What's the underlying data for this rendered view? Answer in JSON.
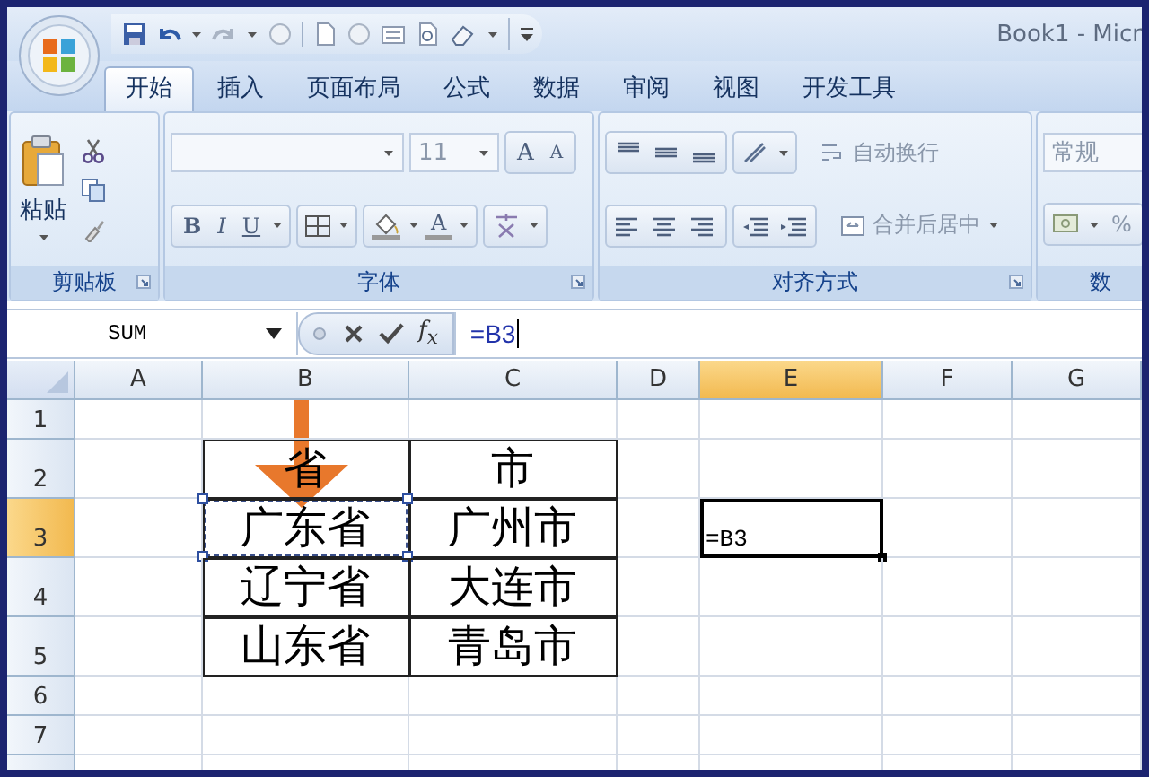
{
  "window": {
    "title": "Book1 - Micr"
  },
  "tabs": [
    {
      "label": "开始",
      "selected": true
    },
    {
      "label": "插入",
      "selected": false
    },
    {
      "label": "页面布局",
      "selected": false
    },
    {
      "label": "公式",
      "selected": false
    },
    {
      "label": "数据",
      "selected": false
    },
    {
      "label": "审阅",
      "selected": false
    },
    {
      "label": "视图",
      "selected": false
    },
    {
      "label": "开发工具",
      "selected": false
    }
  ],
  "ribbon": {
    "clipboard": {
      "label": "剪贴板",
      "paste": "粘贴"
    },
    "font": {
      "label": "字体",
      "size": "11",
      "grow": "A",
      "shrink": "A",
      "bold": "B",
      "italic": "I",
      "underline": "U",
      "font_color_button": "A"
    },
    "alignment": {
      "label": "对齐方式",
      "wrap": "自动换行",
      "merge": "合并后居中"
    },
    "number": {
      "label": "数",
      "format": "常规",
      "percent": "%"
    }
  },
  "formula_bar": {
    "name_box": "SUM",
    "fx": "f$_{x}$",
    "formula": "=B3"
  },
  "sheet": {
    "columns": [
      {
        "label": "A",
        "selected": false
      },
      {
        "label": "B",
        "selected": false
      },
      {
        "label": "C",
        "selected": false
      },
      {
        "label": "D",
        "selected": false
      },
      {
        "label": "E",
        "selected": true
      },
      {
        "label": "F",
        "selected": false
      },
      {
        "label": "G",
        "selected": false
      }
    ],
    "rows": [
      {
        "label": "1",
        "selected": false,
        "cells": [
          {},
          {},
          {},
          {},
          {},
          {},
          {}
        ]
      },
      {
        "label": "2",
        "selected": false,
        "cells": [
          {},
          {
            "text": "省",
            "boxed": true
          },
          {
            "text": "市",
            "boxed": true
          },
          {},
          {},
          {},
          {}
        ]
      },
      {
        "label": "3",
        "selected": true,
        "cells": [
          {},
          {
            "text": "广东省",
            "boxed": true,
            "marquee": true
          },
          {
            "text": "广州市",
            "boxed": true
          },
          {},
          {
            "text": "=B3",
            "active": true
          },
          {},
          {}
        ]
      },
      {
        "label": "4",
        "selected": false,
        "cells": [
          {},
          {
            "text": "辽宁省",
            "boxed": true
          },
          {
            "text": "大连市",
            "boxed": true
          },
          {},
          {},
          {},
          {}
        ]
      },
      {
        "label": "5",
        "selected": false,
        "cells": [
          {},
          {
            "text": "山东省",
            "boxed": true
          },
          {
            "text": "青岛市",
            "boxed": true
          },
          {},
          {},
          {},
          {}
        ]
      },
      {
        "label": "6",
        "selected": false,
        "cells": [
          {},
          {},
          {},
          {},
          {},
          {},
          {}
        ]
      },
      {
        "label": "7",
        "selected": false,
        "cells": [
          {},
          {},
          {},
          {},
          {},
          {},
          {}
        ]
      }
    ]
  }
}
